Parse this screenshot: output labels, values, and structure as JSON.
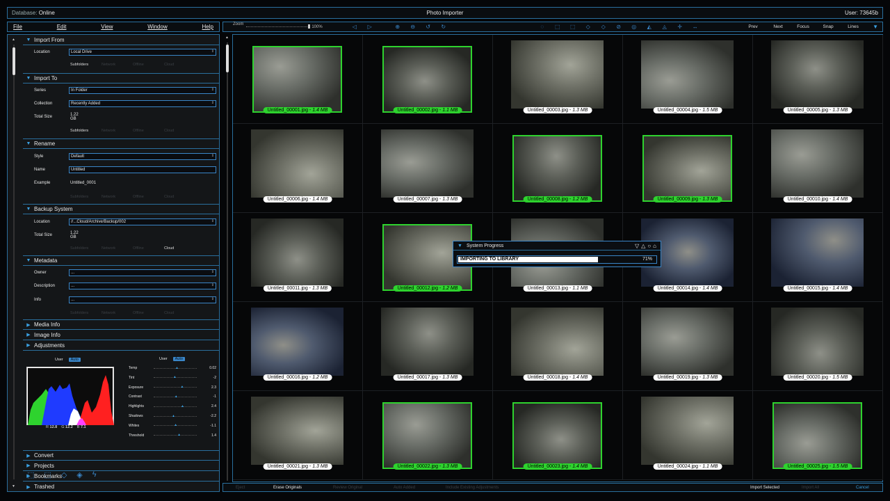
{
  "topbar": {
    "db_label": "Database:",
    "db_value": "Online",
    "title": "Photo Importer",
    "user_label": "User:",
    "user_value": "73645b"
  },
  "menu": [
    "File",
    "Edit",
    "View",
    "Window",
    "Help"
  ],
  "toolbar": {
    "zoom_label": "Zoom",
    "zoom_value": "100%",
    "nav": [
      "Prev",
      "Next",
      "Focus",
      "Snap",
      "Lines"
    ],
    "icons": [
      "back-icon",
      "forward-icon",
      "zoom-in-icon",
      "zoom-out-icon",
      "undo-icon",
      "redo-icon",
      "select-icon",
      "lasso-icon",
      "crop-icon",
      "rotate-icon",
      "flip-icon",
      "erase-icon",
      "brush-icon",
      "mirror-icon",
      "align-icon",
      "move-icon",
      "expand-icon"
    ]
  },
  "left": {
    "import_from": {
      "title": "Import From",
      "location_label": "Location",
      "location_value": "Local Drive",
      "subfolders": [
        "Subfolders",
        "Network",
        "Offline",
        "Cloud"
      ],
      "subfolders_on": [
        true,
        false,
        false,
        false
      ]
    },
    "import_to": {
      "title": "Import To",
      "series_label": "Series",
      "series_value": "In Folder",
      "collection_label": "Collection",
      "collection_value": "Recently Added",
      "total_label": "Total Size",
      "total_value": "1.22 GB",
      "opts": [
        "Subfolders",
        "Network",
        "Offline",
        "Cloud"
      ],
      "opts_on": [
        true,
        false,
        false,
        false
      ]
    },
    "rename": {
      "title": "Rename",
      "style_label": "Style",
      "style_value": "Default",
      "name_label": "Name",
      "name_value": "Untitled",
      "example_label": "Example",
      "example_value": "Untitled_0001",
      "opts": [
        "Subfolders",
        "Network",
        "Offline",
        "Cloud"
      ],
      "opts_on": [
        false,
        false,
        false,
        false
      ]
    },
    "backup": {
      "title": "Backup System",
      "location_label": "Location",
      "location_value": "//...Cloud/Archive/Backup/002",
      "total_label": "Total Size",
      "total_value": "1.22 GB",
      "opts": [
        "Subfolders",
        "Network",
        "Offline",
        "Cloud"
      ],
      "opts_on": [
        false,
        false,
        false,
        true
      ]
    },
    "metadata": {
      "title": "Metadata",
      "owner_label": "Owner",
      "owner_value": "...",
      "desc_label": "Description",
      "desc_value": "...",
      "info_label": "Info",
      "info_value": "...",
      "opts": [
        "Subfolders",
        "Network",
        "Offline",
        "Cloud"
      ],
      "opts_on": [
        false,
        false,
        false,
        false
      ]
    },
    "collapsed": [
      "Media Info",
      "Image Info"
    ],
    "adjustments": {
      "title": "Adjustments",
      "user_label": "User",
      "auto_label": "Auto",
      "rgb": {
        "r_label": "R",
        "r": "12.8",
        "g_label": "G",
        "g": "12.2",
        "b_label": "B",
        "b": "7.1"
      },
      "sliders": [
        {
          "label": "Temp",
          "value": "0.02",
          "pos": 0.5
        },
        {
          "label": "Tint",
          "value": "-2",
          "pos": 0.45
        },
        {
          "label": "Exposure",
          "value": "2.3",
          "pos": 0.62
        },
        {
          "label": "Contrast",
          "value": "-1",
          "pos": 0.48
        },
        {
          "label": "Highlights",
          "value": "2.4",
          "pos": 0.63
        },
        {
          "label": "Shadows",
          "value": "-2.2",
          "pos": 0.42
        },
        {
          "label": "Whites",
          "value": "-1.1",
          "pos": 0.47
        },
        {
          "label": "Threshold",
          "value": "1.4",
          "pos": 0.55
        }
      ],
      "icons": [
        "select-icon",
        "lasso-icon",
        "crop-icon",
        "rotate-icon",
        "flip-icon"
      ]
    },
    "bottom_sections": [
      "Convert",
      "Projects",
      "Bookmarks",
      "Trashed"
    ]
  },
  "photos": [
    {
      "name": "Untitled_00001.jpg",
      "size": "1.4 MB",
      "selected": true
    },
    {
      "name": "Untitled_00002.jpg",
      "size": "1.1 MB",
      "selected": true
    },
    {
      "name": "Untitled_00003.jpg",
      "size": "1.3 MB",
      "selected": false
    },
    {
      "name": "Untitled_00004.jpg",
      "size": "1.5 MB",
      "selected": false
    },
    {
      "name": "Untitled_00005.jpg",
      "size": "1.3 MB",
      "selected": false
    },
    {
      "name": "Untitled_00006.jpg",
      "size": "1.4 MB",
      "selected": false
    },
    {
      "name": "Untitled_00007.jpg",
      "size": "1.3 MB",
      "selected": false
    },
    {
      "name": "Untitled_00008.jpg",
      "size": "1.2 MB",
      "selected": true
    },
    {
      "name": "Untitled_00009.jpg",
      "size": "1.3 MB",
      "selected": true
    },
    {
      "name": "Untitled_00010.jpg",
      "size": "1.4 MB",
      "selected": false
    },
    {
      "name": "Untitled_00011.jpg",
      "size": "1.3 MB",
      "selected": false
    },
    {
      "name": "Untitled_00012.jpg",
      "size": "1.2 MB",
      "selected": true
    },
    {
      "name": "Untitled_00013.jpg",
      "size": "1.1 MB",
      "selected": false
    },
    {
      "name": "Untitled_00014.jpg",
      "size": "1.4 MB",
      "selected": false
    },
    {
      "name": "Untitled_00015.jpg",
      "size": "1.4 MB",
      "selected": false
    },
    {
      "name": "Untitled_00016.jpg",
      "size": "1.2 MB",
      "selected": false
    },
    {
      "name": "Untitled_00017.jpg",
      "size": "1.3 MB",
      "selected": false
    },
    {
      "name": "Untitled_00018.jpg",
      "size": "1.4 MB",
      "selected": false
    },
    {
      "name": "Untitled_00019.jpg",
      "size": "1.3 MB",
      "selected": false
    },
    {
      "name": "Untitled_00020.jpg",
      "size": "1.5 MB",
      "selected": false
    },
    {
      "name": "Untitled_00021.jpg",
      "size": "1.3 MB",
      "selected": false
    },
    {
      "name": "Untitled_00022.jpg",
      "size": "1.3 MB",
      "selected": true
    },
    {
      "name": "Untitled_00023.jpg",
      "size": "1.4 MB",
      "selected": true
    },
    {
      "name": "Untitled_00024.jpg",
      "size": "1.1 MB",
      "selected": false
    },
    {
      "name": "Untitled_00025.jpg",
      "size": "1.5 MB",
      "selected": true
    }
  ],
  "bottombar": {
    "eject": "Eject",
    "erase": "Erase Originals",
    "review": "Review Original",
    "auto_added": "Auto Added",
    "include": "Include Existing Adjustments",
    "import_selected": "Import Selected",
    "import_all": "Import All",
    "cancel": "Cancel"
  },
  "dialog": {
    "title": "System Progress",
    "status": "IMPORTING TO LIBRARY",
    "progress": 0.71,
    "percent": "71%"
  },
  "colors": {
    "accent": "#3a86c8",
    "selected": "#2ed32e",
    "border": "#2a6f9e"
  }
}
